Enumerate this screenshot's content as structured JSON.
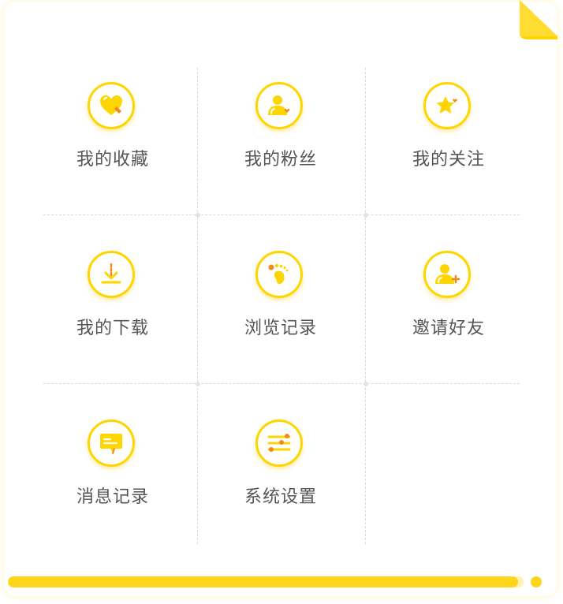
{
  "colors": {
    "accent": "#ffd500",
    "accent_dark": "#f5a623",
    "orange": "#f08a1c",
    "label": "#555555",
    "divider": "#d9d9d9"
  },
  "menu": {
    "items": [
      {
        "label": "我的收藏",
        "icon": "heart-icon"
      },
      {
        "label": "我的粉丝",
        "icon": "user-heart-icon"
      },
      {
        "label": "我的关注",
        "icon": "star-heart-icon"
      },
      {
        "label": "我的下载",
        "icon": "download-icon"
      },
      {
        "label": "浏览记录",
        "icon": "footprint-icon"
      },
      {
        "label": "邀请好友",
        "icon": "add-user-icon"
      },
      {
        "label": "消息记录",
        "icon": "message-icon"
      },
      {
        "label": "系统设置",
        "icon": "settings-sliders-icon"
      }
    ]
  },
  "progress": {
    "value": 0.99
  }
}
